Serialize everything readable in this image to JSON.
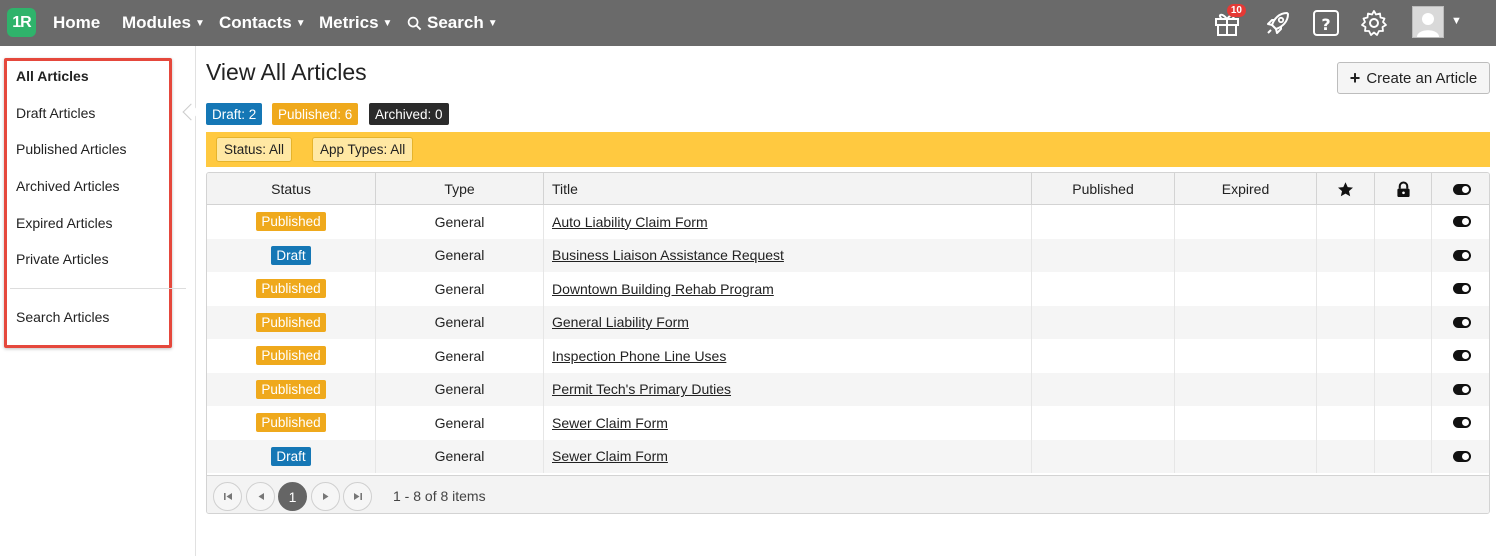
{
  "nav": {
    "logo": "1R",
    "items": [
      {
        "label": "Home",
        "caret": false
      },
      {
        "label": "Modules",
        "caret": true
      },
      {
        "label": "Contacts",
        "caret": true
      },
      {
        "label": "Metrics",
        "caret": true
      },
      {
        "label": "Search",
        "caret": true
      }
    ],
    "gift_count": "10"
  },
  "sidebar": {
    "items": [
      {
        "label": "All Articles",
        "active": true
      },
      {
        "label": "Draft Articles"
      },
      {
        "label": "Published Articles"
      },
      {
        "label": "Archived Articles"
      },
      {
        "label": "Expired Articles"
      },
      {
        "label": "Private Articles"
      }
    ],
    "search_label": "Search Articles"
  },
  "main": {
    "title": "View All Articles",
    "create_label": "Create an Article",
    "counts": [
      {
        "label": "Draft: 2",
        "color": "#1577b5"
      },
      {
        "label": "Published: 6",
        "color": "#efa91c"
      },
      {
        "label": "Archived: 0",
        "color": "#2b2b2b"
      }
    ],
    "filters": [
      "Status: All",
      "App Types: All"
    ]
  },
  "grid": {
    "columns": [
      "Status",
      "Type",
      "Title",
      "Published",
      "Expired"
    ],
    "rows": [
      {
        "status": "Published",
        "type": "General",
        "title": "Auto Liability Claim Form"
      },
      {
        "status": "Draft",
        "type": "General",
        "title": "Business Liaison Assistance Request"
      },
      {
        "status": "Published",
        "type": "General",
        "title": "Downtown Building Rehab Program"
      },
      {
        "status": "Published",
        "type": "General",
        "title": "General Liability Form"
      },
      {
        "status": "Published",
        "type": "General",
        "title": "Inspection Phone Line Uses"
      },
      {
        "status": "Published",
        "type": "General",
        "title": "Permit Tech's Primary Duties"
      },
      {
        "status": "Published",
        "type": "General",
        "title": "Sewer Claim Form"
      },
      {
        "status": "Draft",
        "type": "General",
        "title": "Sewer Claim Form"
      }
    ],
    "status_colors": {
      "Published": "#efa91c",
      "Draft": "#1577b5"
    }
  },
  "pager": {
    "current_page": "1",
    "info": "1 - 8 of 8 items"
  }
}
